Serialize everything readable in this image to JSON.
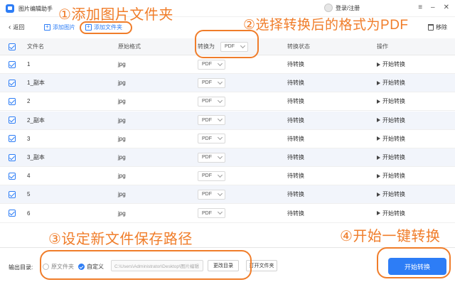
{
  "titlebar": {
    "app_title": "图片编辑助手",
    "login": "登录/注册"
  },
  "toolbar": {
    "back": "返回",
    "add_image": "添加图片",
    "add_folder": "添加文件夹",
    "remove": "移除"
  },
  "table": {
    "headers": {
      "name": "文件名",
      "format": "原始格式",
      "convert_to": "转换为",
      "status": "转换状态",
      "action": "操作"
    },
    "header_select": "PDF",
    "rows": [
      {
        "name": "1",
        "format": "jpg",
        "target": "PDF",
        "status": "待转换",
        "action": "开始转换"
      },
      {
        "name": "1_副本",
        "format": "jpg",
        "target": "PDF",
        "status": "待转换",
        "action": "开始转换"
      },
      {
        "name": "2",
        "format": "jpg",
        "target": "PDF",
        "status": "待转换",
        "action": "开始转换"
      },
      {
        "name": "2_副本",
        "format": "jpg",
        "target": "PDF",
        "status": "待转换",
        "action": "开始转换"
      },
      {
        "name": "3",
        "format": "jpg",
        "target": "PDF",
        "status": "待转换",
        "action": "开始转换"
      },
      {
        "name": "3_副本",
        "format": "jpg",
        "target": "PDF",
        "status": "待转换",
        "action": "开始转换"
      },
      {
        "name": "4",
        "format": "jpg",
        "target": "PDF",
        "status": "待转换",
        "action": "开始转换"
      },
      {
        "name": "5",
        "format": "jpg",
        "target": "PDF",
        "status": "待转换",
        "action": "开始转换"
      },
      {
        "name": "6",
        "format": "jpg",
        "target": "PDF",
        "status": "待转换",
        "action": "开始转换"
      }
    ]
  },
  "footer": {
    "output_label": "输出目录:",
    "option_original": "原文件夹",
    "option_custom": "自定义",
    "path": "C:\\Users\\Administrator\\Desktop\\图片编辑",
    "change_dir": "更改目录",
    "open_folder": "打开文件夹",
    "start": "开始转换"
  },
  "annotations": {
    "step1": "①添加图片文件夹",
    "step2": "②选择转换后的格式为PDF",
    "step3": "③设定新文件保存路径",
    "step4": "④开始一键转换"
  },
  "colors": {
    "accent": "#2d7df6",
    "annotation": "#f07d2a",
    "alt_row": "#f2f5fb"
  }
}
